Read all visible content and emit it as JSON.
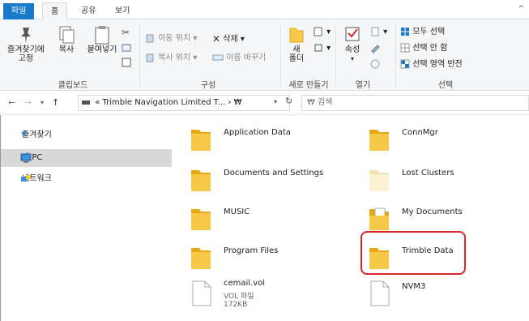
{
  "tabs": {
    "file": "파일",
    "home": "홈",
    "share": "공유",
    "view": "보기"
  },
  "clipboard": {
    "pin_label_1": "즐겨찾기에",
    "pin_label_2": "고정",
    "copy_label": "복사",
    "paste_label": "붙여넣기",
    "group_label": "클립보드"
  },
  "organize": {
    "move_to": "이동 위치",
    "copy_to": "복사 위치",
    "delete": "삭제",
    "rename": "이름 바꾸기",
    "group_label": "구성"
  },
  "new": {
    "folder_label_1": "새",
    "folder_label_2": "폴더",
    "group_label": "새로 만들기"
  },
  "open": {
    "properties": "속성",
    "group_label": "열기"
  },
  "select": {
    "select_all": "모두 선택",
    "select_none": "선택 안 함",
    "invert": "선택 영역 반전",
    "group_label": "선택"
  },
  "address": {
    "path": "« Trimble Navigation Limited T...",
    "current": "₩",
    "search_placeholder": "₩ 검색"
  },
  "nav": {
    "favorites": "즐겨찾기",
    "this_pc": "내 PC",
    "network": "네트워크"
  },
  "items": [
    {
      "name": "Application Data"
    },
    {
      "name": "ConnMgr"
    },
    {
      "name": "Documents and Settings"
    },
    {
      "name": "Lost Clusters"
    },
    {
      "name": "MUSIC"
    },
    {
      "name": "My Documents"
    },
    {
      "name": "Program Files"
    },
    {
      "name": "Trimble Data"
    },
    {
      "name": "cemail.vol",
      "type": "VOL 파일",
      "size": "172KB"
    },
    {
      "name": "NVM3"
    }
  ],
  "colors": {
    "file_tab": "#1979ca",
    "folder": "#f7c948",
    "folder_dark": "#e6a817",
    "highlight": "#d9262b",
    "selected_nav": "#d9d9d9"
  }
}
